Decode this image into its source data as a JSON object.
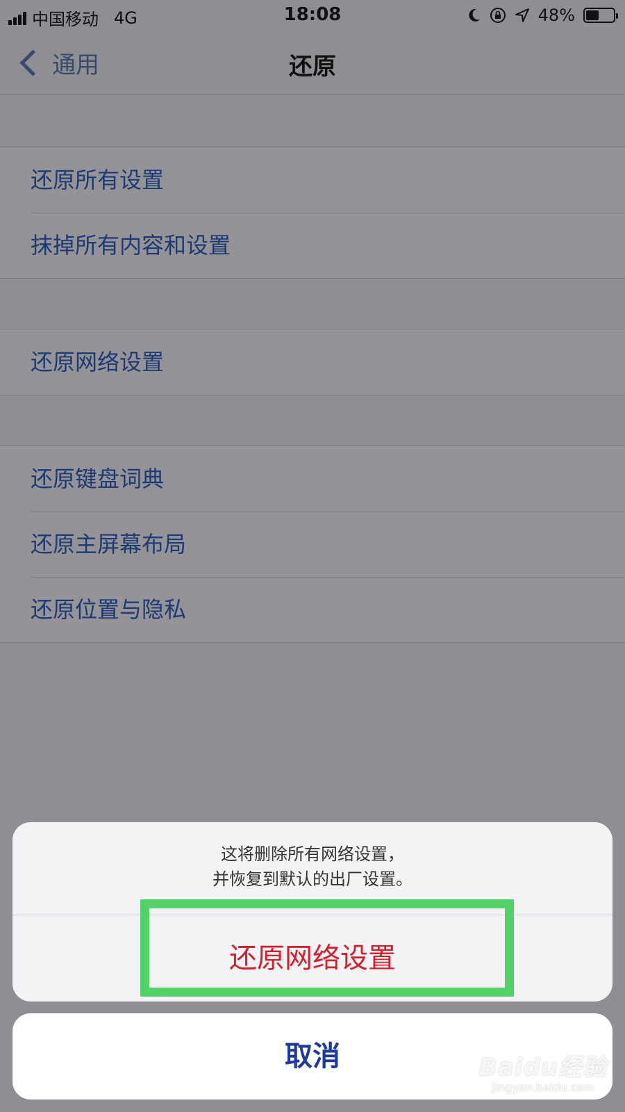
{
  "status_bar": {
    "carrier": "中国移动",
    "network": "4G",
    "time": "18:08",
    "battery": "48%",
    "battery_level": 0.48
  },
  "nav": {
    "back_label": "通用",
    "title": "还原"
  },
  "groups": [
    [
      "还原所有设置",
      "抹掉所有内容和设置"
    ],
    [
      "还原网络设置"
    ],
    [
      "还原键盘词典",
      "还原主屏幕布局",
      "还原位置与隐私"
    ]
  ],
  "action_sheet": {
    "message_line1": "这将删除所有网络设置，",
    "message_line2": "并恢复到默认的出厂设置。",
    "action_label": "还原网络设置",
    "cancel_label": "取消"
  },
  "watermark": {
    "logo_text": "Baidu经验",
    "url": "jingyan.baidu.com"
  },
  "colors": {
    "link_blue": "#1e3a73",
    "destructive_red": "#d0212f",
    "highlight_green": "#53d169"
  }
}
